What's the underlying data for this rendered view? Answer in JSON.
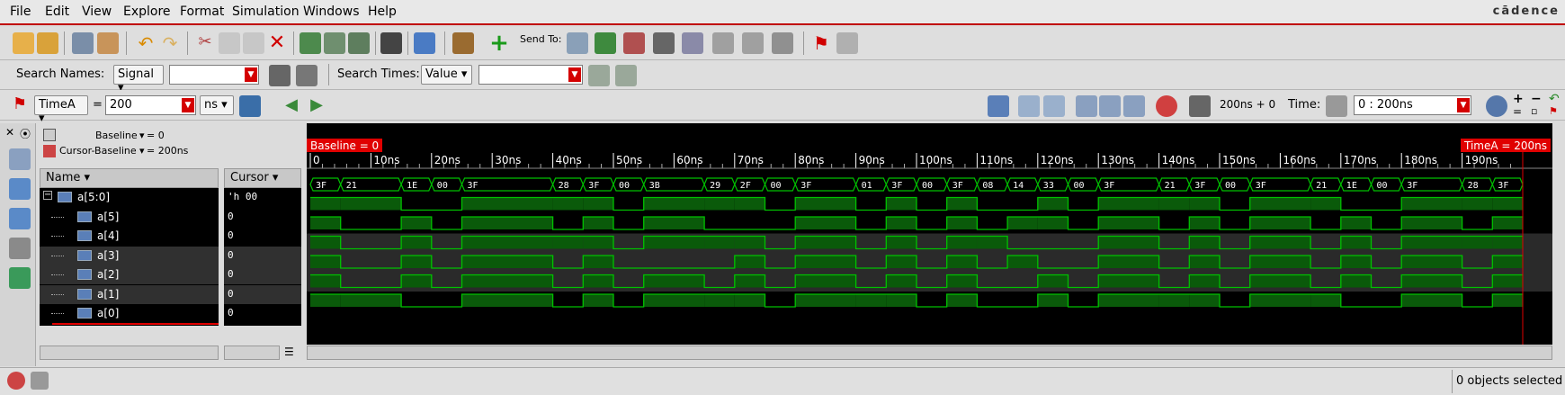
{
  "menu": [
    "File",
    "Edit",
    "View",
    "Explore",
    "Format",
    "Simulation",
    "Windows",
    "Help"
  ],
  "logo": "cādence",
  "toolbar1": {
    "send_to_label": "Send To:"
  },
  "search": {
    "names_label": "Search Names:",
    "names_type": "Signal",
    "times_label": "Search Times:",
    "times_type": "Value"
  },
  "timebar": {
    "marker": "TimeA",
    "eq": "=",
    "value": "200",
    "unit": "ns",
    "sim_time": "200ns + 0",
    "time_label": "Time:",
    "time_range": "0 : 200ns"
  },
  "baseline": {
    "label": "Baseline",
    "baseline_value": "= 0",
    "cursor_baseline_label": "Cursor-Baseline",
    "cursor_baseline_value": "= 200ns"
  },
  "columns": {
    "name": "Name",
    "cursor": "Cursor"
  },
  "signals": [
    {
      "name": "a[5:0]",
      "value": "'h 00",
      "bus": true
    },
    {
      "name": "a[5]",
      "value": "0"
    },
    {
      "name": "a[4]",
      "value": "0"
    },
    {
      "name": "a[3]",
      "value": "0"
    },
    {
      "name": "a[2]",
      "value": "0"
    },
    {
      "name": "a[1]",
      "value": "0"
    },
    {
      "name": "a[0]",
      "value": "0"
    }
  ],
  "waveform": {
    "baseline_flag": "Baseline = 0",
    "cursor_flag": "TimeA = 200ns",
    "tick_labels": [
      "0",
      "10ns",
      "20ns",
      "30ns",
      "40ns",
      "50ns",
      "60ns",
      "70ns",
      "80ns",
      "90ns",
      "100ns",
      "110ns",
      "120ns",
      "130ns",
      "140ns",
      "150ns",
      "160ns",
      "170ns",
      "180ns",
      "190ns"
    ],
    "time_range_ns": [
      0,
      200
    ],
    "bus_values": [
      "3F",
      "21",
      "1E",
      "00",
      "3F",
      "28",
      "3F",
      "00",
      "3B",
      "29",
      "2F",
      "00",
      "3F",
      "01",
      "3F",
      "00",
      "3F",
      "08",
      "14",
      "33",
      "00",
      "3F",
      "21",
      "3F",
      "00",
      "3F",
      "21",
      "1E",
      "00",
      "3F",
      "28",
      "3F",
      "00"
    ],
    "transitions_ns": [
      0,
      5,
      15,
      20,
      25,
      40,
      45,
      50,
      55,
      65,
      70,
      75,
      80,
      90,
      95,
      100,
      105,
      110,
      115,
      120,
      125,
      130,
      140,
      145,
      150,
      155,
      165,
      170,
      175,
      180,
      190,
      195,
      200
    ],
    "colors": {
      "wave": "#00c000",
      "fill": "#0a5a0a",
      "flag": "#e00000"
    }
  },
  "status": {
    "objects_selected": "0 objects selected"
  }
}
